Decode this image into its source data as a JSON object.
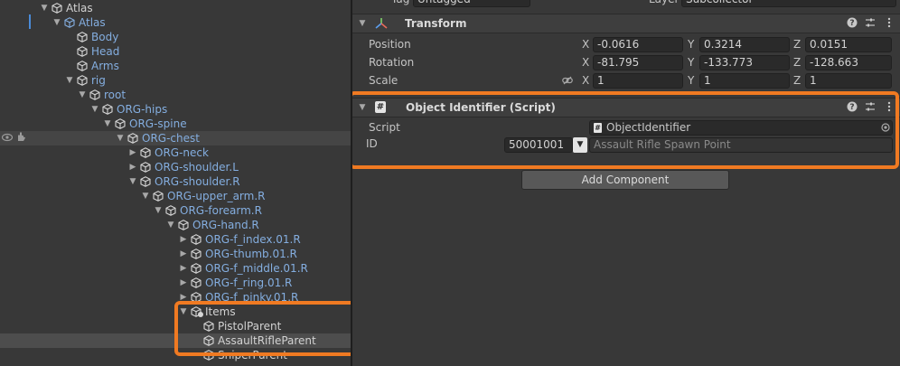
{
  "hierarchy": {
    "items": [
      {
        "label": "Atlas",
        "style": "white",
        "arrow": "▼",
        "prefab": false
      },
      {
        "label": "Atlas",
        "style": "blue",
        "arrow": "▼",
        "prefab": true
      },
      {
        "label": "Body",
        "style": "blue",
        "arrow": "",
        "prefab": false
      },
      {
        "label": "Head",
        "style": "blue",
        "arrow": "",
        "prefab": false
      },
      {
        "label": "Arms",
        "style": "blue",
        "arrow": "",
        "prefab": false
      },
      {
        "label": "rig",
        "style": "blue",
        "arrow": "▼",
        "prefab": false
      },
      {
        "label": "root",
        "style": "blue",
        "arrow": "▼",
        "prefab": false
      },
      {
        "label": "ORG-hips",
        "style": "blue",
        "arrow": "▼",
        "prefab": false
      },
      {
        "label": "ORG-spine",
        "style": "blue",
        "arrow": "▼",
        "prefab": false
      },
      {
        "label": "ORG-chest",
        "style": "blue",
        "arrow": "▼",
        "prefab": false
      },
      {
        "label": "ORG-neck",
        "style": "blue",
        "arrow": "▶",
        "prefab": false
      },
      {
        "label": "ORG-shoulder.L",
        "style": "blue",
        "arrow": "▶",
        "prefab": false
      },
      {
        "label": "ORG-shoulder.R",
        "style": "blue",
        "arrow": "▼",
        "prefab": false
      },
      {
        "label": "ORG-upper_arm.R",
        "style": "blue",
        "arrow": "▼",
        "prefab": false
      },
      {
        "label": "ORG-forearm.R",
        "style": "blue",
        "arrow": "▼",
        "prefab": false
      },
      {
        "label": "ORG-hand.R",
        "style": "blue",
        "arrow": "▼",
        "prefab": false
      },
      {
        "label": "ORG-f_index.01.R",
        "style": "blue",
        "arrow": "▶",
        "prefab": false
      },
      {
        "label": "ORG-thumb.01.R",
        "style": "blue",
        "arrow": "▶",
        "prefab": false
      },
      {
        "label": "ORG-f_middle.01.R",
        "style": "blue",
        "arrow": "▶",
        "prefab": false
      },
      {
        "label": "ORG-f_ring.01.R",
        "style": "blue",
        "arrow": "▶",
        "prefab": false
      },
      {
        "label": "ORG-f_pinky.01.R",
        "style": "blue",
        "arrow": "▶",
        "prefab": false
      },
      {
        "label": "Items",
        "style": "white",
        "arrow": "▼",
        "prefab": false
      },
      {
        "label": "PistolParent",
        "style": "white",
        "arrow": "",
        "prefab": false
      },
      {
        "label": "AssaultRifleParent",
        "style": "white",
        "arrow": "",
        "prefab": false
      },
      {
        "label": "SniperParent",
        "style": "white",
        "arrow": "",
        "prefab": false
      }
    ]
  },
  "inspector": {
    "top_row": {
      "tag_label": "Tag",
      "tag_value": "Untagged",
      "layer_label": "Layer",
      "layer_value": "Subcollector"
    },
    "transform": {
      "title": "Transform",
      "rows": [
        {
          "label": "Position",
          "x": "-0.0616",
          "y": "0.3214",
          "z": "0.0151"
        },
        {
          "label": "Rotation",
          "x": "-81.795",
          "y": "-133.773",
          "z": "-128.663"
        },
        {
          "label": "Scale",
          "x": "1",
          "y": "1",
          "z": "1"
        }
      ],
      "axis": {
        "x": "X",
        "y": "Y",
        "z": "Z"
      }
    },
    "object_identifier": {
      "title": "Object Identifier (Script)",
      "script_label": "Script",
      "script_value": "ObjectIdentifier",
      "id_label": "ID",
      "id_value": "50001001",
      "id_name": "Assault Rifle Spawn Point"
    },
    "add_component_label": "Add Component",
    "icons": {
      "help": "help-icon",
      "presets": "presets-icon",
      "menu": "kebab-menu-icon",
      "link": "link-icon"
    }
  },
  "colors": {
    "highlight": "#f07a22",
    "prefab_blue": "#84aee0",
    "bg": "#383838"
  }
}
